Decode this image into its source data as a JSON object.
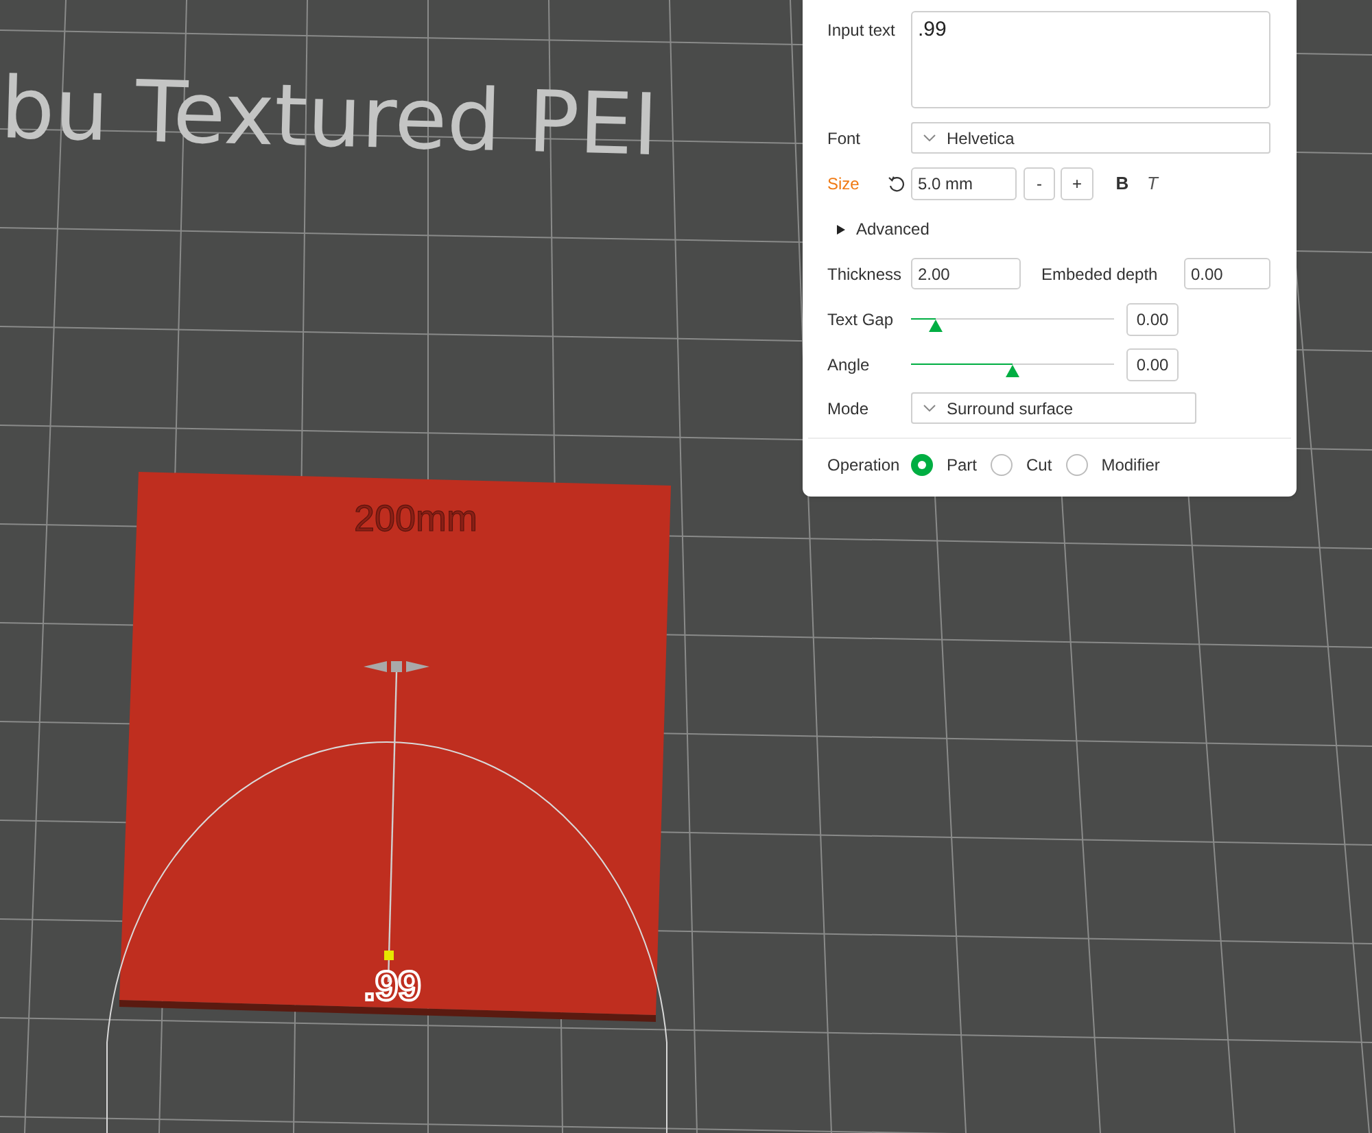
{
  "viewport": {
    "plate_label": "bu Textured PEI",
    "bed_label": "200mm",
    "preview_text": ".99"
  },
  "panel": {
    "input_text": {
      "label": "Input text",
      "value": ".99"
    },
    "font": {
      "label": "Font",
      "value": "Helvetica"
    },
    "size": {
      "label": "Size",
      "value": "5.0 mm",
      "decrement": "-",
      "increment": "+",
      "bold": "B",
      "italic": "T"
    },
    "advanced": {
      "label": "Advanced",
      "expanded": false
    },
    "thickness": {
      "label": "Thickness",
      "value": "2.00"
    },
    "embeded_depth": {
      "label": "Embeded depth",
      "value": "0.00"
    },
    "sliders": [
      {
        "label": "Text Gap",
        "level": 0.12,
        "value": "0.00"
      },
      {
        "label": "Angle",
        "level": 0.5,
        "value": "0.00"
      }
    ],
    "mode": {
      "label": "Mode",
      "value": "Surround surface"
    },
    "operation": {
      "label": "Operation",
      "options": [
        {
          "label": "Part",
          "selected": true
        },
        {
          "label": "Cut",
          "selected": false
        },
        {
          "label": "Modifier",
          "selected": false
        }
      ]
    }
  }
}
